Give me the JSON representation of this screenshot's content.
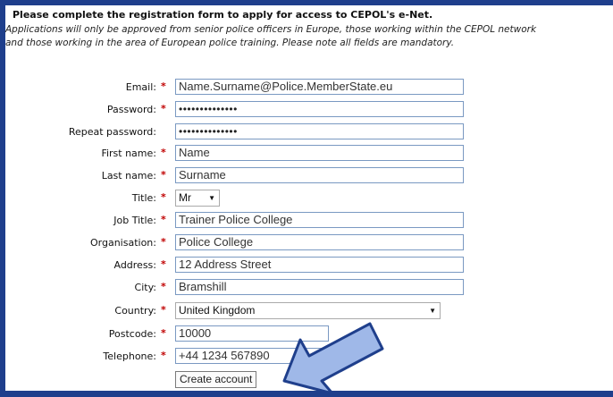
{
  "intro": {
    "title": "Please complete the registration form to apply for access to CEPOL's e-Net.",
    "text_line1": "Applications will only be approved from senior police officers in Europe, those working within the CEPOL network",
    "text_line2": "and those working in the area of European police training. Please note all fields are mandatory."
  },
  "required_marker": "*",
  "fields": {
    "email": {
      "label": "Email:",
      "value": "Name.Surname@Police.MemberState.eu"
    },
    "password": {
      "label": "Password:",
      "value": "••••••••••••••"
    },
    "repeat_password": {
      "label": "Repeat password:",
      "value": "••••••••••••••"
    },
    "first_name": {
      "label": "First name:",
      "value": "Name"
    },
    "last_name": {
      "label": "Last name:",
      "value": "Surname"
    },
    "title": {
      "label": "Title:",
      "value": "Mr"
    },
    "job_title": {
      "label": "Job Title:",
      "value": "Trainer Police College"
    },
    "organisation": {
      "label": "Organisation:",
      "value": "Police College"
    },
    "address": {
      "label": "Address:",
      "value": "12 Address Street"
    },
    "city": {
      "label": "City:",
      "value": "Bramshill"
    },
    "country": {
      "label": "Country:",
      "value": "United Kingdom"
    },
    "postcode": {
      "label": "Postcode:",
      "value": "10000"
    },
    "telephone": {
      "label": "Telephone:",
      "value": "+44 1234 567890"
    }
  },
  "create_button": "Create account",
  "dropdown_glyph": "▼",
  "colors": {
    "background": "#1f3f8c",
    "required": "#c00000",
    "field_border": "#7a99c2",
    "arrow": "#9fb8e8"
  }
}
